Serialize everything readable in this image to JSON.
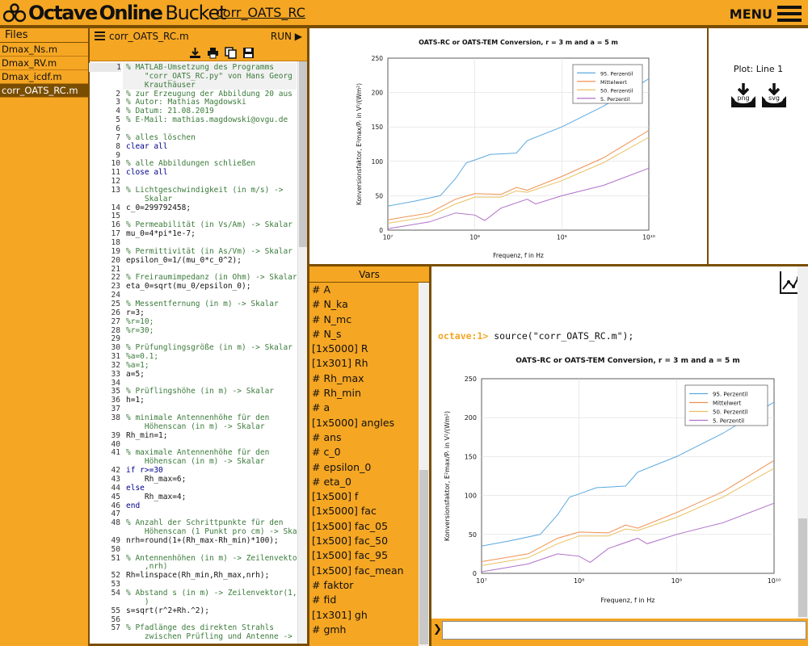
{
  "app": {
    "brand_bold": "Octave",
    "brand_rest": "Online",
    "brand_tail": "Bucket",
    "project": "corr_OATS_RC",
    "menu_label": "MENU"
  },
  "files": {
    "header": "Files",
    "items": [
      {
        "name": "Dmax_Ns.m",
        "selected": false
      },
      {
        "name": "Dmax_RV.m",
        "selected": false
      },
      {
        "name": "Dmax_icdf.m",
        "selected": false
      },
      {
        "name": "corr_OATS_RC.m",
        "selected": true
      }
    ]
  },
  "editor": {
    "filename": "corr_OATS_RC.m",
    "run_label": "RUN ▶",
    "toolbar_icons": [
      "download-icon",
      "print-icon",
      "copy-icon",
      "save-icon"
    ],
    "lines": [
      {
        "n": "1",
        "t": "% MATLAB-Umsetzung des Programms",
        "c": "cm",
        "a": true
      },
      {
        "n": "",
        "t": "    \"corr_OATS_RC.py\" von Hans Georg",
        "c": "cm",
        "a": true
      },
      {
        "n": "",
        "t": "    Krauthäuser",
        "c": "cm",
        "a": true
      },
      {
        "n": "2",
        "t": "% zur Erzeugung der Abbildung 20 aus [1]",
        "c": "cm"
      },
      {
        "n": "3",
        "t": "% Autor: Mathias Magdowski",
        "c": "cm"
      },
      {
        "n": "4",
        "t": "% Datum: 21.08.2019",
        "c": "cm"
      },
      {
        "n": "5",
        "t": "% E-Mail: mathias.magdowski@ovgu.de",
        "c": "cm"
      },
      {
        "n": "6",
        "t": "",
        "c": ""
      },
      {
        "n": "7",
        "t": "% alles löschen",
        "c": "cm"
      },
      {
        "n": "8",
        "t": "clear all",
        "c": "kw"
      },
      {
        "n": "9",
        "t": "",
        "c": ""
      },
      {
        "n": "10",
        "t": "% alle Abbildungen schließen",
        "c": "cm"
      },
      {
        "n": "11",
        "t": "close all",
        "c": "kw"
      },
      {
        "n": "12",
        "t": "",
        "c": ""
      },
      {
        "n": "13",
        "t": "% Lichtgeschwindigkeit (in m/s) ->",
        "c": "cm"
      },
      {
        "n": "",
        "t": "    Skalar",
        "c": "cm"
      },
      {
        "n": "14",
        "t": "c_0=299792458;",
        "c": ""
      },
      {
        "n": "15",
        "t": "",
        "c": ""
      },
      {
        "n": "16",
        "t": "% Permeabilität (in Vs/Am) -> Skalar",
        "c": "cm"
      },
      {
        "n": "17",
        "t": "mu_0=4*pi*1e-7;",
        "c": ""
      },
      {
        "n": "18",
        "t": "",
        "c": ""
      },
      {
        "n": "19",
        "t": "% Permittivität (in As/Vm) -> Skalar",
        "c": "cm"
      },
      {
        "n": "20",
        "t": "epsilon_0=1/(mu_0*c_0^2);",
        "c": ""
      },
      {
        "n": "21",
        "t": "",
        "c": ""
      },
      {
        "n": "22",
        "t": "% Freiraumimpedanz (in Ohm) -> Skalar",
        "c": "cm"
      },
      {
        "n": "23",
        "t": "eta_0=sqrt(mu_0/epsilon_0);",
        "c": ""
      },
      {
        "n": "24",
        "t": "",
        "c": ""
      },
      {
        "n": "25",
        "t": "% Messentfernung (in m) -> Skalar",
        "c": "cm"
      },
      {
        "n": "26",
        "t": "r=3;",
        "c": ""
      },
      {
        "n": "27",
        "t": "%r=10;",
        "c": "cm"
      },
      {
        "n": "28",
        "t": "%r=30;",
        "c": "cm"
      },
      {
        "n": "29",
        "t": "",
        "c": ""
      },
      {
        "n": "30",
        "t": "% Prüfunglingsgröße (in m) -> Skalar",
        "c": "cm"
      },
      {
        "n": "31",
        "t": "%a=0.1;",
        "c": "cm"
      },
      {
        "n": "32",
        "t": "%a=1;",
        "c": "cm"
      },
      {
        "n": "33",
        "t": "a=5;",
        "c": ""
      },
      {
        "n": "34",
        "t": "",
        "c": ""
      },
      {
        "n": "35",
        "t": "% Prüflingshöhe (in m) -> Skalar",
        "c": "cm"
      },
      {
        "n": "36",
        "t": "h=1;",
        "c": ""
      },
      {
        "n": "37",
        "t": "",
        "c": ""
      },
      {
        "n": "38",
        "t": "% minimale Antennenhöhe für den",
        "c": "cm"
      },
      {
        "n": "",
        "t": "    Höhenscan (in m) -> Skalar",
        "c": "cm"
      },
      {
        "n": "39",
        "t": "Rh_min=1;",
        "c": ""
      },
      {
        "n": "40",
        "t": "",
        "c": ""
      },
      {
        "n": "41",
        "t": "% maximale Antennenhöhe für den",
        "c": "cm"
      },
      {
        "n": "",
        "t": "    Höhenscan (in m) -> Skalar",
        "c": "cm"
      },
      {
        "n": "42",
        "t": "if r>=30",
        "c": "kw"
      },
      {
        "n": "43",
        "t": "    Rh_max=6;",
        "c": ""
      },
      {
        "n": "44",
        "t": "else",
        "c": "kw"
      },
      {
        "n": "45",
        "t": "    Rh_max=4;",
        "c": ""
      },
      {
        "n": "46",
        "t": "end",
        "c": "kw"
      },
      {
        "n": "47",
        "t": "",
        "c": ""
      },
      {
        "n": "48",
        "t": "% Anzahl der Schrittpunkte für den",
        "c": "cm"
      },
      {
        "n": "",
        "t": "    Höhenscan (1 Punkt pro cm) -> Skalar",
        "c": "cm"
      },
      {
        "n": "49",
        "t": "nrh=round(1+(Rh_max-Rh_min)*100);",
        "c": ""
      },
      {
        "n": "50",
        "t": "",
        "c": ""
      },
      {
        "n": "51",
        "t": "% Antennenhöhen (in m) -> Zeilenvektor(1",
        "c": "cm"
      },
      {
        "n": "",
        "t": "    ,nrh)",
        "c": "cm"
      },
      {
        "n": "52",
        "t": "Rh=linspace(Rh_min,Rh_max,nrh);",
        "c": ""
      },
      {
        "n": "53",
        "t": "",
        "c": ""
      },
      {
        "n": "54",
        "t": "% Abstand s (in m) -> Zeilenvektor(1,nrh",
        "c": "cm"
      },
      {
        "n": "",
        "t": "    )",
        "c": "cm"
      },
      {
        "n": "55",
        "t": "s=sqrt(r^2+Rh.^2);",
        "c": ""
      },
      {
        "n": "56",
        "t": "",
        "c": ""
      },
      {
        "n": "57",
        "t": "% Pfadlänge des direkten Strahls",
        "c": "cm"
      },
      {
        "n": "",
        "t": "    zwischen Prüfling und Antenne ->",
        "c": "cm"
      }
    ]
  },
  "plot_side": {
    "label": "Plot: Line 1",
    "buttons": [
      {
        "icon": "download-png-icon",
        "label": "png"
      },
      {
        "icon": "download-svg-icon",
        "label": "svg"
      }
    ]
  },
  "vars": {
    "header": "Vars",
    "items": [
      "# A",
      "# N_ka",
      "# N_mc",
      "# N_s",
      "[1x5000] R",
      "[1x301] Rh",
      "# Rh_max",
      "# Rh_min",
      "# a",
      "[1x5000] angles",
      "# ans",
      "# c_0",
      "# epsilon_0",
      "# eta_0",
      "[1x500] f",
      "[1x5000] fac",
      "[1x500] fac_05",
      "[1x500] fac_50",
      "[1x500] fac_95",
      "[1x500] fac_mean",
      "# faktor",
      "# fid",
      "[1x301] gh",
      "# gmh"
    ]
  },
  "console": {
    "prompt": "octave:1>",
    "command": "source(\"corr_OATS_RC.m\");",
    "plot_icon": "plot-toggle-icon"
  },
  "cmd": {
    "arrow": "❯",
    "value": ""
  },
  "colors": {
    "orange": "#f5a623",
    "brown": "#7a4e00"
  },
  "chart_data": {
    "type": "line",
    "title": "OATS-RC or OATS-TEM Conversion, r = 3 m and a = 5 m",
    "xlabel": "Frequenz, f in Hz",
    "ylabel": "Konversionsfaktor, E²max/Pᵣ in V²/(Wm²)",
    "x_scale": "log",
    "xlim": [
      10000000.0,
      10000000000.0
    ],
    "ylim": [
      0,
      250
    ],
    "xticks": [
      "10⁷",
      "10⁸",
      "10⁹",
      "10¹⁰"
    ],
    "yticks": [
      0,
      50,
      100,
      150,
      200,
      250
    ],
    "grid": true,
    "legend_position": "top-right",
    "series": [
      {
        "name": "95. Perzentil",
        "color": "#5aa9e0",
        "x": [
          10000000.0,
          20000000.0,
          40000000.0,
          60000000.0,
          80000000.0,
          100000000.0,
          150000000.0,
          300000000.0,
          400000000.0,
          1000000000.0,
          3000000000.0,
          10000000000.0
        ],
        "y": [
          35,
          42,
          50,
          75,
          98,
          102,
          110,
          112,
          130,
          150,
          180,
          220
        ]
      },
      {
        "name": "Mittelwert",
        "color": "#f09050",
        "x": [
          10000000.0,
          30000000.0,
          60000000.0,
          100000000.0,
          200000000.0,
          300000000.0,
          400000000.0,
          1000000000.0,
          3000000000.0,
          10000000000.0
        ],
        "y": [
          15,
          25,
          45,
          53,
          52,
          62,
          58,
          78,
          105,
          145
        ]
      },
      {
        "name": "50. Perzentil",
        "color": "#e8c060",
        "x": [
          10000000.0,
          30000000.0,
          60000000.0,
          100000000.0,
          200000000.0,
          300000000.0,
          400000000.0,
          1000000000.0,
          3000000000.0,
          10000000000.0
        ],
        "y": [
          10,
          20,
          38,
          48,
          48,
          57,
          55,
          72,
          98,
          135
        ]
      },
      {
        "name": "5. Perzentil",
        "color": "#b070c8",
        "x": [
          10000000.0,
          30000000.0,
          60000000.0,
          100000000.0,
          130000000.0,
          200000000.0,
          400000000.0,
          500000000.0,
          1000000000.0,
          3000000000.0,
          10000000000.0
        ],
        "y": [
          2,
          12,
          25,
          22,
          14,
          32,
          45,
          38,
          50,
          65,
          90
        ]
      }
    ]
  }
}
